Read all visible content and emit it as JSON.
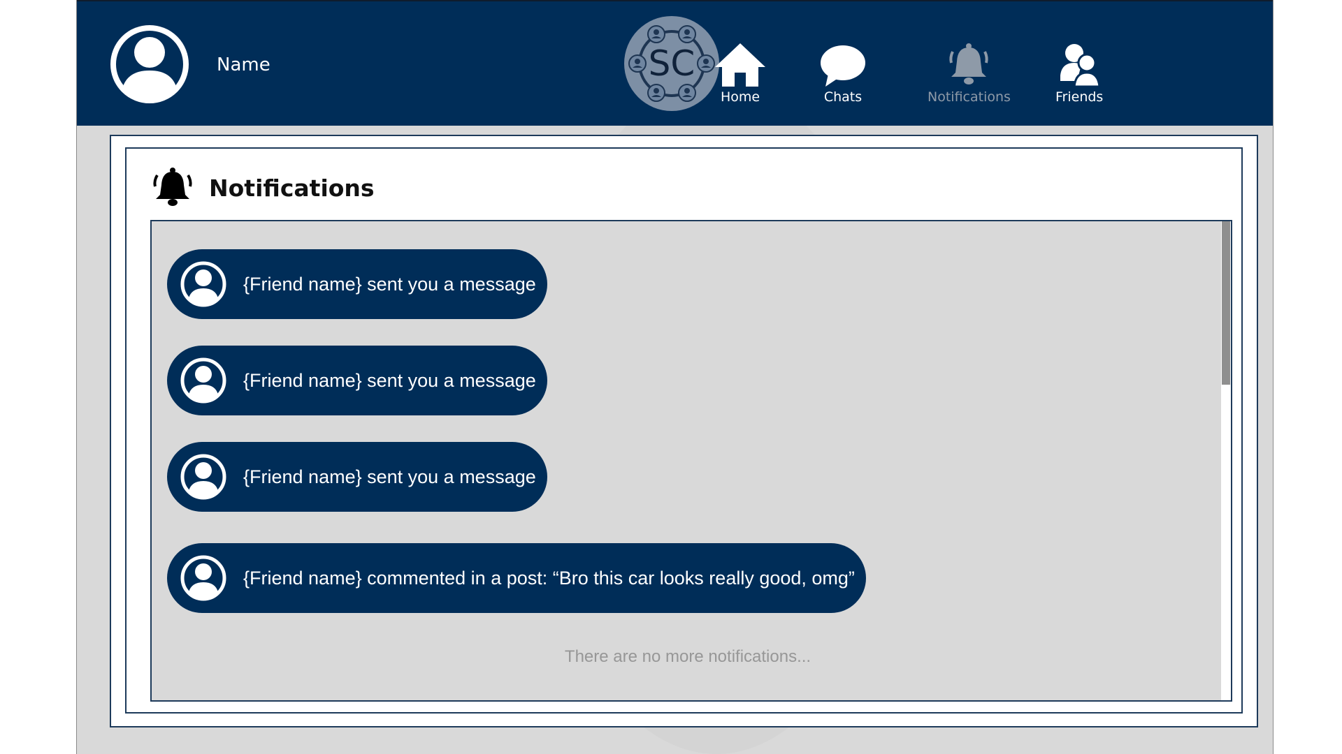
{
  "header": {
    "user_name": "Name",
    "logo_text": "SC",
    "nav": [
      {
        "label": "Home",
        "icon": "home-icon",
        "active": false
      },
      {
        "label": "Chats",
        "icon": "chat-bubble-icon",
        "active": false
      },
      {
        "label": "Notifications",
        "icon": "bell-icon",
        "active": true
      },
      {
        "label": "Friends",
        "icon": "friends-icon",
        "active": false
      }
    ]
  },
  "panel": {
    "title": "Notifications",
    "icon": "bell-icon"
  },
  "notifications": [
    {
      "text": "{Friend name} sent you a message"
    },
    {
      "text": "{Friend name} sent you a message"
    },
    {
      "text": "{Friend name} sent you a message"
    },
    {
      "text": "{Friend name} commented in a post: “Bro this car looks really good, omg”"
    }
  ],
  "end_text": "There are no more notifications...",
  "colors": {
    "navy": "#002d58",
    "panel_bg": "#d9d9d9",
    "muted_text": "#979797"
  }
}
